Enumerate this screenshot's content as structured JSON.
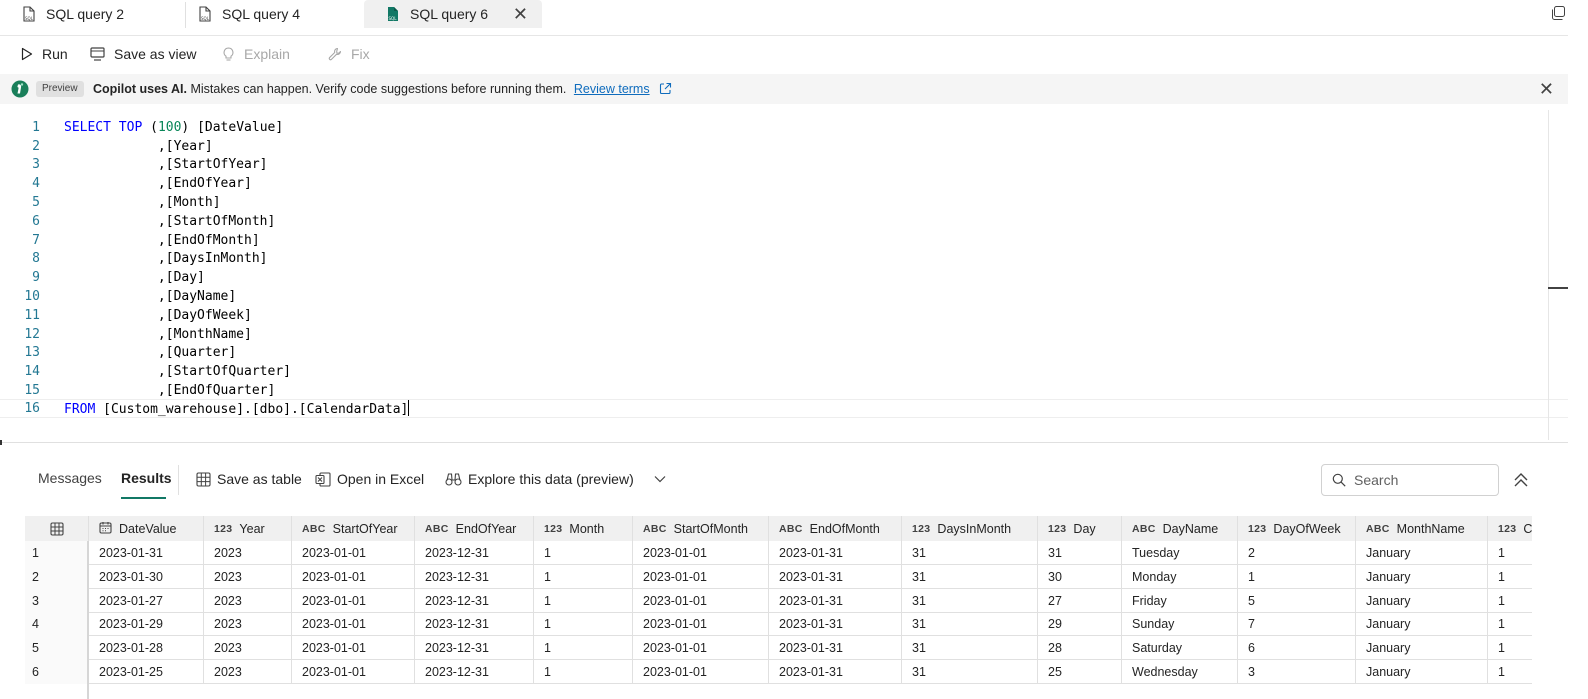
{
  "tabs": [
    {
      "label": "SQL query 2",
      "active": false
    },
    {
      "label": "SQL query 4",
      "active": false
    },
    {
      "label": "SQL query 6",
      "active": true
    }
  ],
  "toolbar": {
    "run": "Run",
    "save_as_view": "Save as view",
    "explain": "Explain",
    "fix": "Fix"
  },
  "copilot": {
    "badge": "Preview",
    "bold": "Copilot uses AI.",
    "text": " Mistakes can happen. Verify code suggestions before running them.",
    "link": "Review terms"
  },
  "editor": {
    "line_numbers": [
      "1",
      "2",
      "3",
      "4",
      "5",
      "6",
      "7",
      "8",
      "9",
      "10",
      "11",
      "12",
      "13",
      "14",
      "15",
      "16"
    ],
    "line1": {
      "kw1": "SELECT",
      "kw2": "TOP",
      "open": " (",
      "num": "100",
      "rest": ") [DateValue]"
    },
    "lines": [
      "            ,[Year]",
      "            ,[StartOfYear]",
      "            ,[EndOfYear]",
      "            ,[Month]",
      "            ,[StartOfMonth]",
      "            ,[EndOfMonth]",
      "            ,[DaysInMonth]",
      "            ,[Day]",
      "            ,[DayName]",
      "            ,[DayOfWeek]",
      "            ,[MonthName]",
      "            ,[Quarter]",
      "            ,[StartOfQuarter]",
      "            ,[EndOfQuarter]"
    ],
    "line16": {
      "kw": "FROM",
      "rest": " [Custom_warehouse].[dbo].[CalendarData]"
    }
  },
  "results": {
    "tab_messages": "Messages",
    "tab_results": "Results",
    "save_as_table": "Save as table",
    "open_in_excel": "Open in Excel",
    "explore": "Explore this data (preview)",
    "search_placeholder": "Search"
  },
  "grid": {
    "columns": [
      {
        "type": "cal",
        "name": "DateValue"
      },
      {
        "type": "123",
        "name": "Year"
      },
      {
        "type": "ABC",
        "name": "StartOfYear"
      },
      {
        "type": "ABC",
        "name": "EndOfYear"
      },
      {
        "type": "123",
        "name": "Month"
      },
      {
        "type": "ABC",
        "name": "StartOfMonth"
      },
      {
        "type": "ABC",
        "name": "EndOfMonth"
      },
      {
        "type": "123",
        "name": "DaysInMonth"
      },
      {
        "type": "123",
        "name": "Day"
      },
      {
        "type": "ABC",
        "name": "DayName"
      },
      {
        "type": "123",
        "name": "DayOfWeek"
      },
      {
        "type": "ABC",
        "name": "MonthName"
      },
      {
        "type": "123",
        "name": "C"
      }
    ],
    "rows": [
      [
        "1",
        "2023-01-31",
        "2023",
        "2023-01-01",
        "2023-12-31",
        "1",
        "2023-01-01",
        "2023-01-31",
        "31",
        "31",
        "Tuesday",
        "2",
        "January",
        "1"
      ],
      [
        "2",
        "2023-01-30",
        "2023",
        "2023-01-01",
        "2023-12-31",
        "1",
        "2023-01-01",
        "2023-01-31",
        "31",
        "30",
        "Monday",
        "1",
        "January",
        "1"
      ],
      [
        "3",
        "2023-01-27",
        "2023",
        "2023-01-01",
        "2023-12-31",
        "1",
        "2023-01-01",
        "2023-01-31",
        "31",
        "27",
        "Friday",
        "5",
        "January",
        "1"
      ],
      [
        "4",
        "2023-01-29",
        "2023",
        "2023-01-01",
        "2023-12-31",
        "1",
        "2023-01-01",
        "2023-01-31",
        "31",
        "29",
        "Sunday",
        "7",
        "January",
        "1"
      ],
      [
        "5",
        "2023-01-28",
        "2023",
        "2023-01-01",
        "2023-12-31",
        "1",
        "2023-01-01",
        "2023-01-31",
        "31",
        "28",
        "Saturday",
        "6",
        "January",
        "1"
      ],
      [
        "6",
        "2023-01-25",
        "2023",
        "2023-01-01",
        "2023-12-31",
        "1",
        "2023-01-01",
        "2023-01-31",
        "31",
        "25",
        "Wednesday",
        "3",
        "January",
        "1"
      ]
    ]
  }
}
